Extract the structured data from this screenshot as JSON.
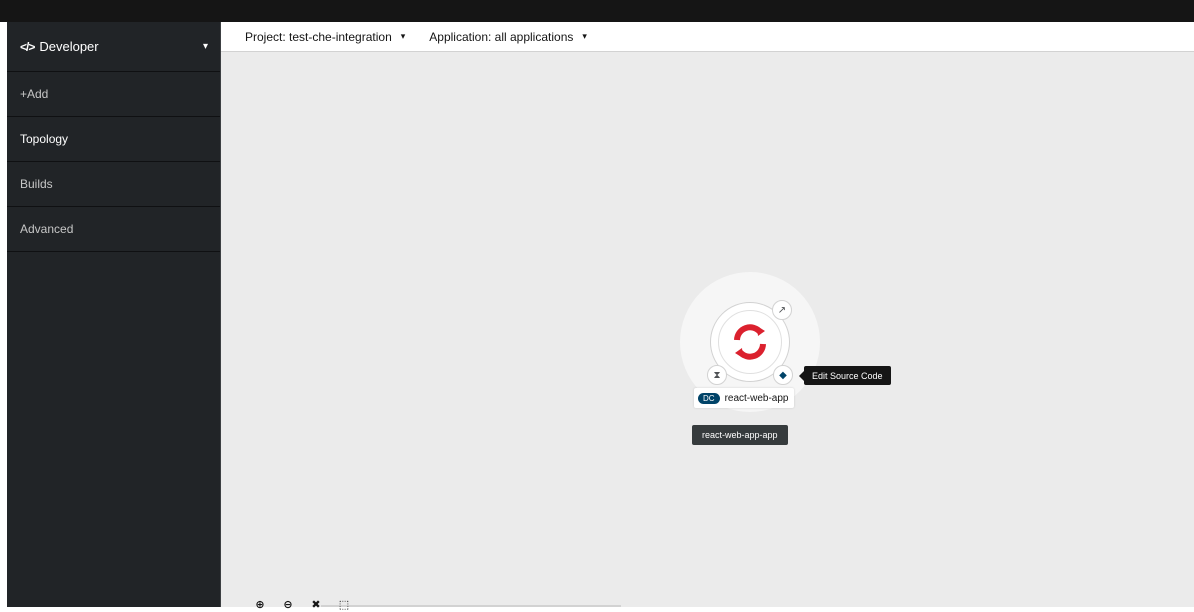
{
  "sidebar": {
    "perspective": {
      "icon": "code-icon",
      "icon_glyph": "</>",
      "label": "Developer",
      "caret": "▾"
    },
    "items": [
      {
        "label": "+Add",
        "active": false
      },
      {
        "label": "Topology",
        "active": true
      },
      {
        "label": "Builds",
        "active": false
      },
      {
        "label": "Advanced",
        "active": false
      }
    ]
  },
  "context_bar": {
    "project": {
      "label": "Project: test-che-integration",
      "caret": "▾"
    },
    "application": {
      "label": "Application: all applications",
      "caret": "▾"
    }
  },
  "topology": {
    "node": {
      "type_badge": "DC",
      "name": "react-web-app",
      "tooltip": "Edit Source Code",
      "decorators": {
        "top_right": "external-link-icon",
        "bottom_left": "hourglass-icon",
        "bottom_right": "source-code-icon"
      }
    },
    "application_group": "react-web-app-app",
    "zoom_controls": [
      "zoom-in-icon",
      "zoom-out-icon",
      "fit-to-screen-icon",
      "expand-icon"
    ]
  },
  "colors": {
    "nav_bg": "#212427",
    "top_bar": "#151515",
    "canvas_bg": "#ebebeb",
    "openshift_red": "#db212e",
    "dc_badge": "#004368"
  }
}
